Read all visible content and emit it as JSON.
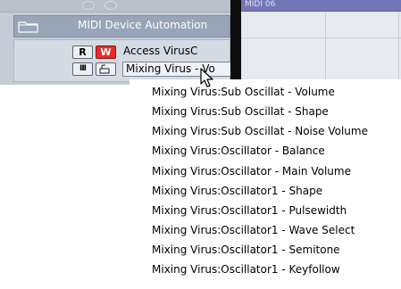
{
  "track_header": {
    "folder_label": "MIDI Device Automation",
    "track_name": "Access VirusC",
    "record_label": "R",
    "write_label": "W",
    "lanes_label": "III",
    "parameter_value": "Mixing Virus - Vo"
  },
  "arrange": {
    "part_label": "MIDI 06"
  },
  "menu": {
    "items": [
      "Mixing Virus:Sub Oscillat - Volume",
      "Mixing Virus:Sub Oscillat - Shape",
      "Mixing Virus:Sub Oscillat - Noise Volume",
      "Mixing Virus:Oscillator - Balance",
      "Mixing Virus:Oscillator - Main Volume",
      "Mixing Virus:Oscillator1 - Shape",
      "Mixing Virus:Oscillator1 - Pulsewidth",
      "Mixing Virus:Oscillator1 - Wave Select",
      "Mixing Virus:Oscillator1 - Semitone",
      "Mixing Virus:Oscillator1 - Keyfollow"
    ]
  },
  "colors": {
    "write_button": "#e82a2a",
    "folder_row": "#98a4b7",
    "part_bar": "#7476b8"
  },
  "icons": [
    "folder-icon",
    "lock-icon",
    "mouse-pointer-icon"
  ]
}
